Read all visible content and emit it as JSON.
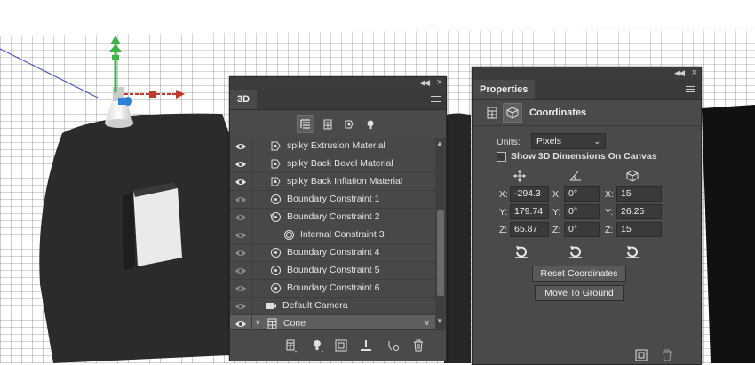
{
  "panel_3d": {
    "tab_label": "3D",
    "filters": [
      "scene-filter",
      "mesh-filter",
      "material-filter",
      "light-filter"
    ],
    "layers": [
      {
        "label": "spiky Extrusion Material",
        "icon": "material-icon",
        "visible": true,
        "indent": 1
      },
      {
        "label": "spiky Back Bevel Material",
        "icon": "material-icon",
        "visible": true,
        "indent": 1
      },
      {
        "label": "spiky Back Inflation Material",
        "icon": "material-icon",
        "visible": true,
        "indent": 1
      },
      {
        "label": "Boundary Constraint 1",
        "icon": "constraint-icon",
        "visible": false,
        "indent": 1
      },
      {
        "label": "Boundary Constraint 2",
        "icon": "constraint-icon",
        "visible": false,
        "indent": 1,
        "expanded": true
      },
      {
        "label": "Internal Constraint 3",
        "icon": "internal-constraint-icon",
        "visible": false,
        "indent": 2
      },
      {
        "label": "Boundary Constraint 4",
        "icon": "constraint-icon",
        "visible": false,
        "indent": 1
      },
      {
        "label": "Boundary Constraint 5",
        "icon": "constraint-icon",
        "visible": false,
        "indent": 1
      },
      {
        "label": "Boundary Constraint 6",
        "icon": "constraint-icon",
        "visible": false,
        "indent": 1
      },
      {
        "label": "Default Camera",
        "icon": "camera-icon",
        "visible": false,
        "indent": 0
      },
      {
        "label": "Cone",
        "icon": "mesh-icon",
        "visible": true,
        "indent": 0,
        "selected": true,
        "expanded": true
      }
    ],
    "toolbar": [
      "add-mesh-icon",
      "add-light-icon",
      "render-icon",
      "drop-to-ground-icon",
      "material-drop-icon",
      "trash-icon"
    ]
  },
  "properties": {
    "tab_label": "Properties",
    "section_title": "Coordinates",
    "units_label": "Units:",
    "units_value": "Pixels",
    "show_3d_label": "Show 3D Dimensions On Canvas",
    "show_3d_checked": false,
    "position": {
      "x_label": "X:",
      "x": "-294.3",
      "y_label": "Y:",
      "y": "179.74",
      "z_label": "Z:",
      "z": "65.87"
    },
    "rotation": {
      "x_label": "X:",
      "x": "0°",
      "y_label": "Y:",
      "y": "0°",
      "z_label": "Z:",
      "z": "0°"
    },
    "scale": {
      "x_label": "X:",
      "x": "15",
      "y_label": "Y:",
      "y": "26.25",
      "z_label": "Z:",
      "z": "15"
    },
    "reset_coordinates_label": "Reset Coordinates",
    "move_to_ground_label": "Move To Ground"
  },
  "colors": {
    "panel_bg": "#4a4a4a",
    "selected_row": "#5f5f5f",
    "gizmo_green": "#3db34a",
    "gizmo_red": "#c0392b",
    "gizmo_blue": "#2f7fd6"
  }
}
